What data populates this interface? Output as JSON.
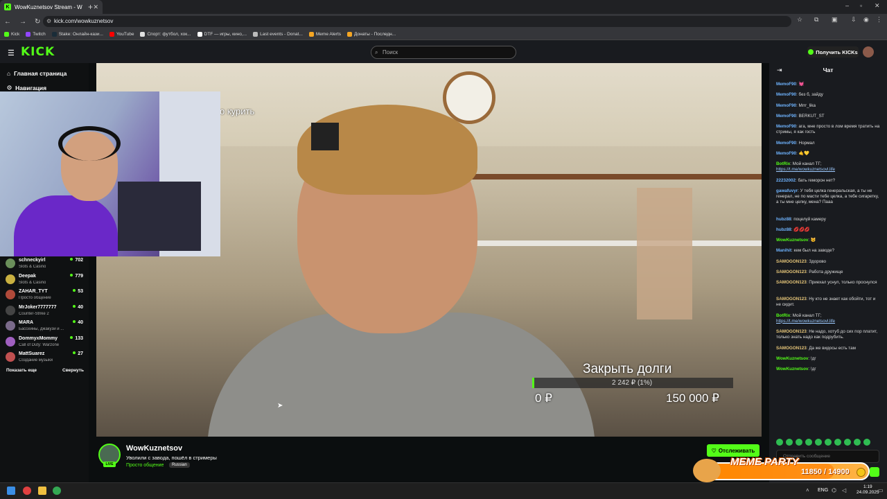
{
  "browser": {
    "tab_title": "WowKuznetsov Stream - W",
    "url": "kick.com/wowkuznetsov",
    "bookmarks": [
      {
        "label": "Kick",
        "color": "#53fc18"
      },
      {
        "label": "Twitch",
        "color": "#9146ff"
      },
      {
        "label": "Stake: Онлайн-кази...",
        "color": "#1a2c38"
      },
      {
        "label": "YouTube",
        "color": "#ff0000"
      },
      {
        "label": "Спорт: футбол, хок...",
        "color": "#e0e0e0"
      },
      {
        "label": "DTF — игры, кино,...",
        "color": "#ffffff"
      },
      {
        "label": "Last events - Donat...",
        "color": "#bbbbbb"
      },
      {
        "label": "Meme Alerts",
        "color": "#f5a623"
      },
      {
        "label": "Донаты - Последн...",
        "color": "#f5a623"
      }
    ]
  },
  "header": {
    "logo": "KICK",
    "search_placeholder": "Поиск",
    "get_kicks": "Получить KICKs"
  },
  "sidebar": {
    "nav": [
      "Главная страница",
      "Навигация"
    ],
    "channels": [
      {
        "name": "schneckyirl",
        "category": "Slots & Casino",
        "viewers": "702",
        "color": "#6a8f5a"
      },
      {
        "name": "Deepak",
        "category": "Slots & Casino",
        "viewers": "779",
        "color": "#c9b040"
      },
      {
        "name": "ZAHAR_TYT",
        "category": "Просто общение",
        "viewers": "53",
        "color": "#b04a3a"
      },
      {
        "name": "MrJoker7777777",
        "category": "Counter-Strike 2",
        "viewers": "40",
        "color": "#444"
      },
      {
        "name": "MARA",
        "category": "Бассейны, джакузи и ...",
        "viewers": "40",
        "color": "#7a6a8a"
      },
      {
        "name": "DommyxMommy",
        "category": "Call of Duty: Warzone",
        "viewers": "133",
        "color": "#a060c0"
      },
      {
        "name": "MattSuarez",
        "category": "Создание музыки",
        "viewers": "27",
        "color": "#c05050"
      }
    ],
    "show_more": "Показать еще",
    "collapse": "Свернуть"
  },
  "video": {
    "overlay_text": "о курить",
    "goal": {
      "title": "Закрыть долги",
      "progress_text": "2 242 ₽ (1%)",
      "progress_fraction": 0.01,
      "min": "0 ₽",
      "max": "150 000 ₽"
    }
  },
  "stream": {
    "streamer": "WowKuznetsov",
    "live": "LIVE",
    "title": "Уволили с завода,  пошёл в стримеры",
    "category": "Просто общение",
    "language": "Russian",
    "follow": "Отслеживать"
  },
  "chat": {
    "header": "Чат",
    "messages": [
      {
        "user": "MemoF90",
        "color": "#6fb4ff",
        "text": ": 💓"
      },
      {
        "user": "MemoF90",
        "color": "#6fb4ff",
        "text": ": без б, зайду"
      },
      {
        "user": "MemoF90",
        "color": "#6fb4ff",
        "text": ": Mrrr_lika"
      },
      {
        "user": "MemoF90",
        "color": "#6fb4ff",
        "text": ": BERKUT_ST"
      },
      {
        "user": "MemoF90",
        "color": "#6fb4ff",
        "text": ": ага, мне просто в лом время тратить на стримы, я как гость"
      },
      {
        "user": "MemoF90",
        "color": "#6fb4ff",
        "text": ": Нормал"
      },
      {
        "user": "MemoF90",
        "color": "#6fb4ff",
        "text": ": 🤙💛"
      },
      {
        "user": "BotRix",
        "color": "#53fc18",
        "text": ": Мой канал ТГ;",
        "link": "https://t.me/wowkuznetsovl.life"
      },
      {
        "user": "22232002",
        "color": "#6fb4ff",
        "text": ": бать геморон нет?"
      },
      {
        "user": "gawafuvyr",
        "color": "#6fb4ff",
        "text": ": У тебя целка генеральская, а ты не генерал, не по масти тебе целка, а тебе сигаретку, а ты мне целку, мена? Пааа"
      },
      {
        "user": "hubz88",
        "color": "#6fb4ff",
        "text": ": поцелуй камеру"
      },
      {
        "user": "hubz88",
        "color": "#6fb4ff",
        "text": ": 💋💋💋"
      },
      {
        "user": "WowKuznetsov",
        "color": "#53fc18",
        "text": ": 😼"
      },
      {
        "user": "Manihit",
        "color": "#6fb4ff",
        "text": ": кем был на заводе?"
      },
      {
        "user": "SAMOGON123",
        "color": "#e8c77a",
        "text": ": Здорово"
      },
      {
        "user": "SAMOGON123",
        "color": "#e8c77a",
        "text": ": Работа дружище"
      },
      {
        "user": "SAMOGON123",
        "color": "#e8c77a",
        "text": ": Приехал уснул, только проснулся"
      },
      {
        "user": "SAMOGON123",
        "color": "#e8c77a",
        "text": ": Ну кто не знает как обойти, тот и не сидит."
      },
      {
        "user": "BotRix",
        "color": "#53fc18",
        "text": ": Мой канал ТГ;",
        "link": "https://t.me/wowkuznetsovl.life"
      },
      {
        "user": "SAMOGON123",
        "color": "#e8c77a",
        "text": ": Не надо, хотуб до сих пор платит, только знать надо как подрубить."
      },
      {
        "user": "SAMOGON123",
        "color": "#e8c77a",
        "text": ": Да же видосы есть там"
      },
      {
        "user": "WowKuznetsov",
        "color": "#53fc18",
        "text": ": !дг"
      },
      {
        "user": "WowKuznetsov",
        "color": "#53fc18",
        "text": ": !дг"
      }
    ],
    "input_placeholder": "Отправить сообщение"
  },
  "meme_party": {
    "title": "MEME PARTY",
    "count": "11850 / 14900",
    "progress_fraction": 0.795
  },
  "taskbar": {
    "lang": "ENG",
    "time": "1:19",
    "date": "24.09.2025"
  },
  "colors": {
    "accent": "#53fc18",
    "background": "#0b0e0f",
    "panel": "#191b1f"
  }
}
